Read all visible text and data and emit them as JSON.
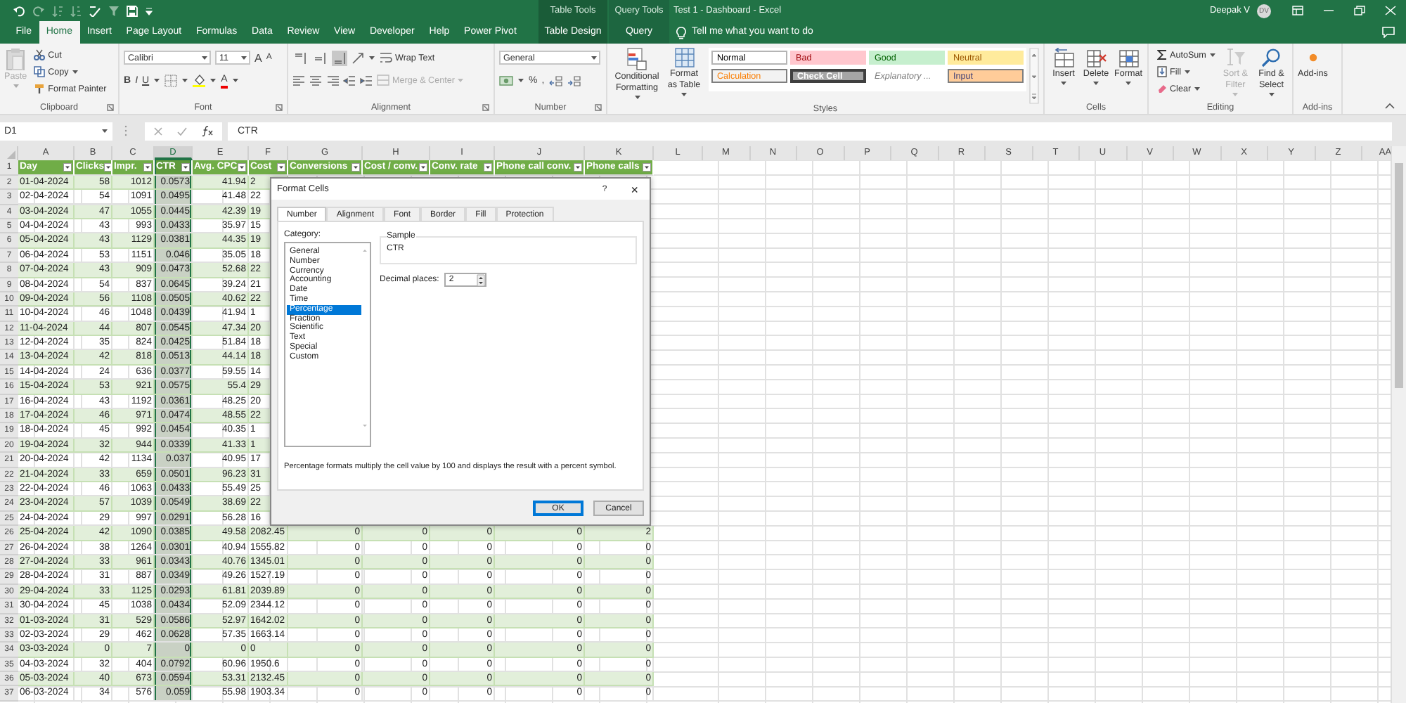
{
  "title_bar": {
    "context_labels": [
      "Table Tools",
      "Query Tools"
    ],
    "title": "Test 1 - Dashboard - Excel",
    "user": "Deepak V",
    "avatar": "DV"
  },
  "tabs": [
    {
      "label": "File",
      "selected": false,
      "kind": "normal"
    },
    {
      "label": "Home",
      "selected": true,
      "kind": "normal"
    },
    {
      "label": "Insert",
      "selected": false,
      "kind": "normal"
    },
    {
      "label": "Page Layout",
      "selected": false,
      "kind": "normal"
    },
    {
      "label": "Formulas",
      "selected": false,
      "kind": "normal"
    },
    {
      "label": "Data",
      "selected": false,
      "kind": "normal"
    },
    {
      "label": "Review",
      "selected": false,
      "kind": "normal"
    },
    {
      "label": "View",
      "selected": false,
      "kind": "normal"
    },
    {
      "label": "Developer",
      "selected": false,
      "kind": "normal"
    },
    {
      "label": "Help",
      "selected": false,
      "kind": "normal"
    },
    {
      "label": "Power Pivot",
      "selected": false,
      "kind": "normal"
    },
    {
      "label": "Table Design",
      "selected": false,
      "kind": "context"
    },
    {
      "label": "Query",
      "selected": false,
      "kind": "context"
    }
  ],
  "tell_me": {
    "placeholder": "Tell me what you want to do"
  },
  "ribbon": {
    "clipboard": {
      "label": "Clipboard",
      "paste": {
        "label": "Paste",
        "disabled": true
      },
      "cut": "Cut",
      "copy": "Copy",
      "format_painter": "Format Painter"
    },
    "font": {
      "label": "Font",
      "font_name": "Calibri",
      "font_size": "11",
      "grow": "A",
      "shrink": "A",
      "bold": "B",
      "italic": "I",
      "underline": "U",
      "font_color": "A"
    },
    "alignment": {
      "label": "Alignment",
      "vertical": [
        {
          "selected": false
        },
        {
          "selected": false
        },
        {
          "selected": true
        }
      ],
      "wrap_text": "Wrap Text",
      "merge_center": {
        "label": "Merge & Center",
        "disabled": true
      }
    },
    "number": {
      "label": "Number",
      "format": "General",
      "percent": "%",
      "comma": ","
    },
    "styles": {
      "label": "Styles",
      "conditional_formatting": "Conditional Formatting",
      "format_as_table": "Format as Table",
      "cell_styles": [
        {
          "label": "Normal",
          "kind": "normal"
        },
        {
          "label": "Bad",
          "kind": "bad"
        },
        {
          "label": "Good",
          "kind": "good"
        },
        {
          "label": "Neutral",
          "kind": "neutral"
        },
        {
          "label": "Calculation",
          "kind": "calculation"
        },
        {
          "label": "Check Cell",
          "kind": "check"
        },
        {
          "label": "Explanatory ...",
          "kind": "explanatory"
        },
        {
          "label": "Input",
          "kind": "input"
        }
      ]
    },
    "cells": {
      "label": "Cells",
      "buttons": [
        "Insert",
        "Delete",
        "Format"
      ]
    },
    "editing": {
      "label": "Editing",
      "autosum": "AutoSum",
      "fill": "Fill",
      "clear": "Clear",
      "sort_filter": {
        "label": "Sort & Filter",
        "disabled": true
      },
      "find_select": "Find & Select"
    },
    "addins": {
      "label": "Add-ins",
      "button": "Add-ins"
    }
  },
  "formula_bar": {
    "name_box": "D1",
    "formula": "CTR"
  },
  "sheet": {
    "column_headers": [
      {
        "label": "A",
        "selected": false
      },
      {
        "label": "B",
        "selected": false
      },
      {
        "label": "C",
        "selected": false
      },
      {
        "label": "D",
        "selected": true
      },
      {
        "label": "E",
        "selected": false
      },
      {
        "label": "F",
        "selected": false
      },
      {
        "label": "G",
        "selected": false
      },
      {
        "label": "H",
        "selected": false
      },
      {
        "label": "I",
        "selected": false
      },
      {
        "label": "J",
        "selected": false
      },
      {
        "label": "K",
        "selected": false
      },
      {
        "label": "L",
        "selected": false
      },
      {
        "label": "M",
        "selected": false
      },
      {
        "label": "N",
        "selected": false
      },
      {
        "label": "O",
        "selected": false
      },
      {
        "label": "P",
        "selected": false
      },
      {
        "label": "Q",
        "selected": false
      },
      {
        "label": "R",
        "selected": false
      },
      {
        "label": "S",
        "selected": false
      },
      {
        "label": "T",
        "selected": false
      },
      {
        "label": "U",
        "selected": false
      },
      {
        "label": "V",
        "selected": false
      },
      {
        "label": "W",
        "selected": false
      },
      {
        "label": "X",
        "selected": false
      },
      {
        "label": "Y",
        "selected": false
      },
      {
        "label": "Z",
        "selected": false
      },
      {
        "label": "AA",
        "selected": false
      }
    ],
    "row_headers": [
      "1",
      "2",
      "3",
      "4",
      "5",
      "6",
      "7",
      "8",
      "9",
      "10",
      "11",
      "12",
      "13",
      "14",
      "15",
      "16",
      "17",
      "18",
      "19",
      "20",
      "21",
      "22",
      "23",
      "24",
      "25",
      "26",
      "27",
      "28",
      "29",
      "30",
      "31",
      "32",
      "33",
      "34",
      "35",
      "36",
      "37"
    ]
  },
  "table": {
    "columns": [
      "Day",
      "Clicks",
      "Impr.",
      "CTR",
      "Avg. CPC",
      "Cost",
      "Conversions",
      "Cost / conv.",
      "Conv. rate",
      "Phone call conv.",
      "Phone calls"
    ],
    "rows": [
      {
        "cells": [
          "01-04-2024",
          "58",
          "1012",
          "0.0573",
          "41.94",
          "2"
        ]
      },
      {
        "cells": [
          "02-04-2024",
          "54",
          "1091",
          "0.0495",
          "41.48",
          "22"
        ]
      },
      {
        "cells": [
          "03-04-2024",
          "47",
          "1055",
          "0.0445",
          "42.39",
          "19"
        ]
      },
      {
        "cells": [
          "04-04-2024",
          "43",
          "993",
          "0.0433",
          "35.97",
          "15"
        ]
      },
      {
        "cells": [
          "05-04-2024",
          "43",
          "1129",
          "0.0381",
          "44.35",
          "19"
        ]
      },
      {
        "cells": [
          "06-04-2024",
          "53",
          "1151",
          "0.046",
          "35.05",
          "18"
        ]
      },
      {
        "cells": [
          "07-04-2024",
          "43",
          "909",
          "0.0473",
          "52.68",
          "22"
        ]
      },
      {
        "cells": [
          "08-04-2024",
          "54",
          "837",
          "0.0645",
          "39.24",
          "21"
        ]
      },
      {
        "cells": [
          "09-04-2024",
          "56",
          "1108",
          "0.0505",
          "40.62",
          "22"
        ]
      },
      {
        "cells": [
          "10-04-2024",
          "46",
          "1048",
          "0.0439",
          "41.94",
          "1"
        ]
      },
      {
        "cells": [
          "11-04-2024",
          "44",
          "807",
          "0.0545",
          "47.34",
          "20"
        ]
      },
      {
        "cells": [
          "12-04-2024",
          "35",
          "824",
          "0.0425",
          "51.84",
          "18"
        ]
      },
      {
        "cells": [
          "13-04-2024",
          "42",
          "818",
          "0.0513",
          "44.14",
          "18"
        ]
      },
      {
        "cells": [
          "14-04-2024",
          "24",
          "636",
          "0.0377",
          "59.55",
          "14"
        ]
      },
      {
        "cells": [
          "15-04-2024",
          "53",
          "921",
          "0.0575",
          "55.4",
          "29"
        ]
      },
      {
        "cells": [
          "16-04-2024",
          "43",
          "1192",
          "0.0361",
          "48.25",
          "20"
        ]
      },
      {
        "cells": [
          "17-04-2024",
          "46",
          "971",
          "0.0474",
          "48.55",
          "22"
        ]
      },
      {
        "cells": [
          "18-04-2024",
          "45",
          "992",
          "0.0454",
          "40.35",
          "1"
        ]
      },
      {
        "cells": [
          "19-04-2024",
          "32",
          "944",
          "0.0339",
          "41.33",
          "1"
        ]
      },
      {
        "cells": [
          "20-04-2024",
          "42",
          "1134",
          "0.037",
          "40.95",
          "17"
        ]
      },
      {
        "cells": [
          "21-04-2024",
          "33",
          "659",
          "0.0501",
          "96.23",
          "31"
        ]
      },
      {
        "cells": [
          "22-04-2024",
          "46",
          "1063",
          "0.0433",
          "55.49",
          "25"
        ]
      },
      {
        "cells": [
          "23-04-2024",
          "57",
          "1039",
          "0.0549",
          "38.69",
          "22"
        ]
      },
      {
        "cells": [
          "24-04-2024",
          "29",
          "997",
          "0.0291",
          "56.28",
          "16"
        ]
      },
      {
        "cells": [
          "25-04-2024",
          "42",
          "1090",
          "0.0385",
          "49.58",
          "2082.45",
          "0",
          "0",
          "0",
          "0",
          "2"
        ]
      },
      {
        "cells": [
          "26-04-2024",
          "38",
          "1264",
          "0.0301",
          "40.94",
          "1555.82",
          "0",
          "0",
          "0",
          "0",
          "0"
        ]
      },
      {
        "cells": [
          "27-04-2024",
          "33",
          "961",
          "0.0343",
          "40.76",
          "1345.01",
          "0",
          "0",
          "0",
          "0",
          "0"
        ]
      },
      {
        "cells": [
          "28-04-2024",
          "31",
          "887",
          "0.0349",
          "49.26",
          "1527.19",
          "0",
          "0",
          "0",
          "0",
          "0"
        ]
      },
      {
        "cells": [
          "29-04-2024",
          "33",
          "1125",
          "0.0293",
          "61.81",
          "2039.89",
          "0",
          "0",
          "0",
          "0",
          "0"
        ]
      },
      {
        "cells": [
          "30-04-2024",
          "45",
          "1038",
          "0.0434",
          "52.09",
          "2344.12",
          "0",
          "0",
          "0",
          "0",
          "0"
        ]
      },
      {
        "cells": [
          "01-03-2024",
          "31",
          "529",
          "0.0586",
          "52.97",
          "1642.02",
          "0",
          "0",
          "0",
          "0",
          "0"
        ]
      },
      {
        "cells": [
          "02-03-2024",
          "29",
          "462",
          "0.0628",
          "57.35",
          "1663.14",
          "0",
          "0",
          "0",
          "0",
          "0"
        ]
      },
      {
        "cells": [
          "03-03-2024",
          "0",
          "7",
          "0",
          "0",
          "0",
          "0",
          "0",
          "0",
          "0",
          "0"
        ]
      },
      {
        "cells": [
          "04-03-2024",
          "32",
          "404",
          "0.0792",
          "60.96",
          "1950.6",
          "0",
          "0",
          "0",
          "0",
          "0"
        ]
      },
      {
        "cells": [
          "05-03-2024",
          "40",
          "673",
          "0.0594",
          "53.31",
          "2132.45",
          "0",
          "0",
          "0",
          "0",
          "0"
        ]
      },
      {
        "cells": [
          "06-03-2024",
          "34",
          "576",
          "0.059",
          "55.98",
          "1903.34",
          "0",
          "0",
          "0",
          "0",
          "0"
        ]
      }
    ]
  },
  "dialog": {
    "title": "Format Cells",
    "help": "?",
    "close": "×",
    "tabs": [
      {
        "label": "Number",
        "selected": true
      },
      {
        "label": "Alignment",
        "selected": false
      },
      {
        "label": "Font",
        "selected": false
      },
      {
        "label": "Border",
        "selected": false
      },
      {
        "label": "Fill",
        "selected": false
      },
      {
        "label": "Protection",
        "selected": false
      }
    ],
    "category_label": "Category:",
    "categories": [
      {
        "label": "General",
        "selected": false
      },
      {
        "label": "Number",
        "selected": false
      },
      {
        "label": "Currency",
        "selected": false
      },
      {
        "label": "Accounting",
        "selected": false
      },
      {
        "label": "Date",
        "selected": false
      },
      {
        "label": "Time",
        "selected": false
      },
      {
        "label": "Percentage",
        "selected": true
      },
      {
        "label": "Fraction",
        "selected": false
      },
      {
        "label": "Scientific",
        "selected": false
      },
      {
        "label": "Text",
        "selected": false
      },
      {
        "label": "Special",
        "selected": false
      },
      {
        "label": "Custom",
        "selected": false
      }
    ],
    "sample_label": "Sample",
    "sample": "CTR",
    "decimal_label": "Decimal places:",
    "decimal_value": "2",
    "description": "Percentage formats multiply the cell value by 100 and displays the result with a percent symbol.",
    "buttons": [
      {
        "label": "OK",
        "kind": "default"
      },
      {
        "label": "Cancel",
        "kind": "normal"
      }
    ]
  }
}
